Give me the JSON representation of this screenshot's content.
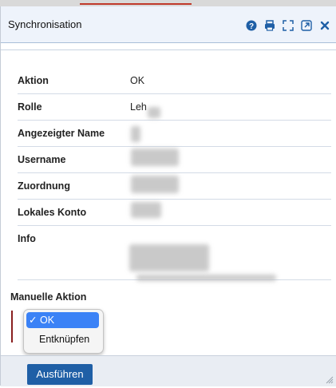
{
  "dialog": {
    "title": "Synchronisation",
    "title_icons": [
      "help-icon",
      "print-icon",
      "expand-icon",
      "popout-icon",
      "close-icon"
    ]
  },
  "fields": [
    {
      "label": "Aktion",
      "value": "OK"
    },
    {
      "label": "Rolle",
      "value": "Leh"
    },
    {
      "label": "Angezeigter Name",
      "value": ""
    },
    {
      "label": "Username",
      "value": ""
    },
    {
      "label": "Zuordnung",
      "value": ""
    },
    {
      "label": "Lokales Konto",
      "value": ""
    },
    {
      "label": "Info",
      "value": ""
    }
  ],
  "manual_action": {
    "label": "Manuelle Aktion",
    "options": [
      "OK",
      "Entknüpfen"
    ],
    "selected": "OK",
    "check_glyph": "✓"
  },
  "footer": {
    "run_label": "Ausführen"
  },
  "colors": {
    "titlebar_bg": "#eef3fb",
    "primary_button": "#1f5fa6",
    "selected_option": "#3b82f6",
    "close_icon": "#1f5fa6"
  }
}
